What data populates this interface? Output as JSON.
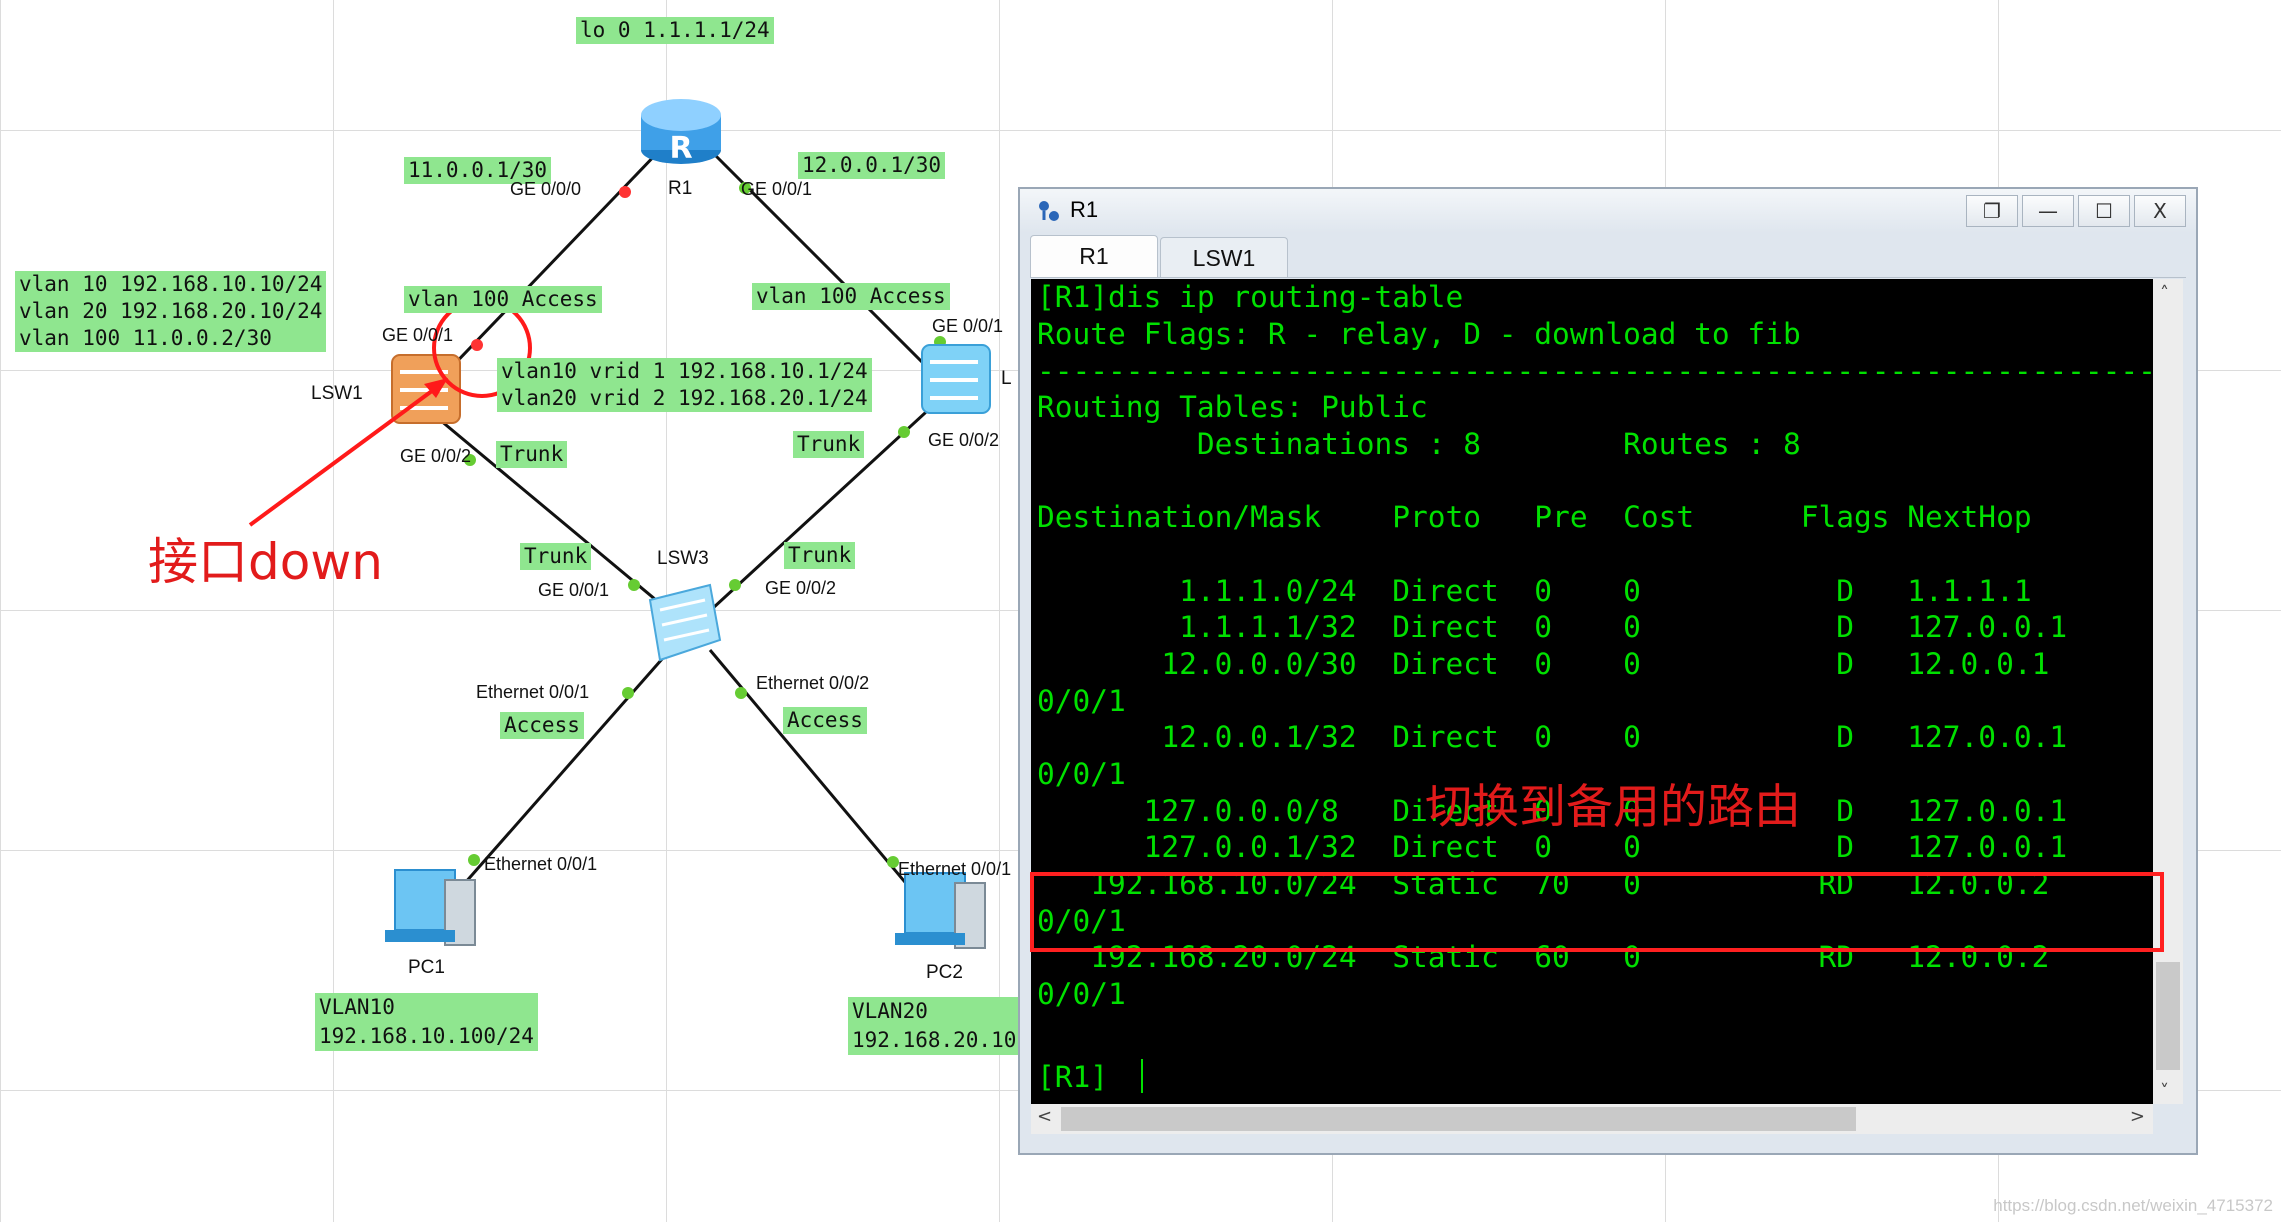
{
  "topology": {
    "labels": {
      "lo0": "lo 0 1.1.1.1/24",
      "r1_left_ip": "11.0.0.1/30",
      "r1_right_ip": "12.0.0.1/30",
      "lsw1_vlans": [
        "vlan 10 192.168.10.10/24",
        "vlan 20 192.168.20.10/24",
        "vlan 100 11.0.0.2/30"
      ],
      "lsw1_access": "vlan 100 Access",
      "lsw2_access": "vlan 100 Access",
      "vrid": [
        "vlan10 vrid 1 192.168.10.1/24",
        "vlan20 vrid 2 192.168.20.1/24"
      ],
      "trunk_lsw1": "Trunk",
      "trunk_lsw2": "Trunk",
      "trunk_lsw3_left": "Trunk",
      "trunk_lsw3_right": "Trunk",
      "access_left": "Access",
      "access_right": "Access",
      "pc1_info": [
        "VLAN10",
        "192.168.10.100/24"
      ],
      "pc2_info": [
        "VLAN20",
        "192.168.20.10"
      ]
    },
    "devices": {
      "r1": "R1",
      "lsw1": "LSW1",
      "lsw2_partial": "L",
      "lsw3": "LSW3",
      "pc1": "PC1",
      "pc2": "PC2"
    },
    "ports": {
      "r1_ge000": "GE 0/0/0",
      "r1_ge001": "GE 0/0/1",
      "lsw1_ge001": "GE 0/0/1",
      "lsw1_ge002": "GE 0/0/2",
      "lsw2_ge001": "GE 0/0/1",
      "lsw2_ge002": "GE 0/0/2",
      "lsw3_ge001": "GE 0/0/1",
      "lsw3_ge002": "GE 0/0/2",
      "lsw3_eth001": "Ethernet 0/0/1",
      "lsw3_eth002": "Ethernet 0/0/2",
      "pc1_eth": "Ethernet 0/0/1",
      "pc2_eth": "Ethernet 0/0/1"
    },
    "annotations": {
      "interface_down": "接口down",
      "switch_route": "切换到备用的路由"
    }
  },
  "window": {
    "title": "R1",
    "tabs": [
      "R1",
      "LSW1"
    ],
    "active_tab": "R1",
    "buttons": {
      "restore": "❐",
      "minimize": "—",
      "maximize": "☐",
      "close": "X"
    }
  },
  "terminal": {
    "lines": [
      "[R1]dis ip routing-table",
      "Route Flags: R - relay, D - download to fib",
      "------------------------------------------------------------------------------",
      "Routing Tables: Public",
      "         Destinations : 8        Routes : 8",
      "",
      "Destination/Mask    Proto   Pre  Cost      Flags NextHop",
      "",
      "        1.1.1.0/24  Direct  0    0           D   1.1.1.1",
      "        1.1.1.1/32  Direct  0    0           D   127.0.0.1",
      "       12.0.0.0/30  Direct  0    0           D   12.0.0.1",
      "0/0/1",
      "       12.0.0.1/32  Direct  0    0           D   127.0.0.1",
      "0/0/1",
      "      127.0.0.0/8   Direct  0    0           D   127.0.0.1",
      "      127.0.0.1/32  Direct  0    0           D   127.0.0.1",
      "   192.168.10.0/24  Static  70   0          RD   12.0.0.2",
      "0/0/1",
      "   192.168.20.0/24  Static  60   0          RD   12.0.0.2",
      "0/0/1",
      "",
      "",
      "[R1]"
    ]
  },
  "watermark": "https://blog.csdn.net/weixin_4715372",
  "colors": {
    "label_bg": "#8fe68f",
    "term_text": "#00e000",
    "annotation": "#e21b1b",
    "link_up": "#66cc33",
    "link_down": "#ff3333"
  }
}
